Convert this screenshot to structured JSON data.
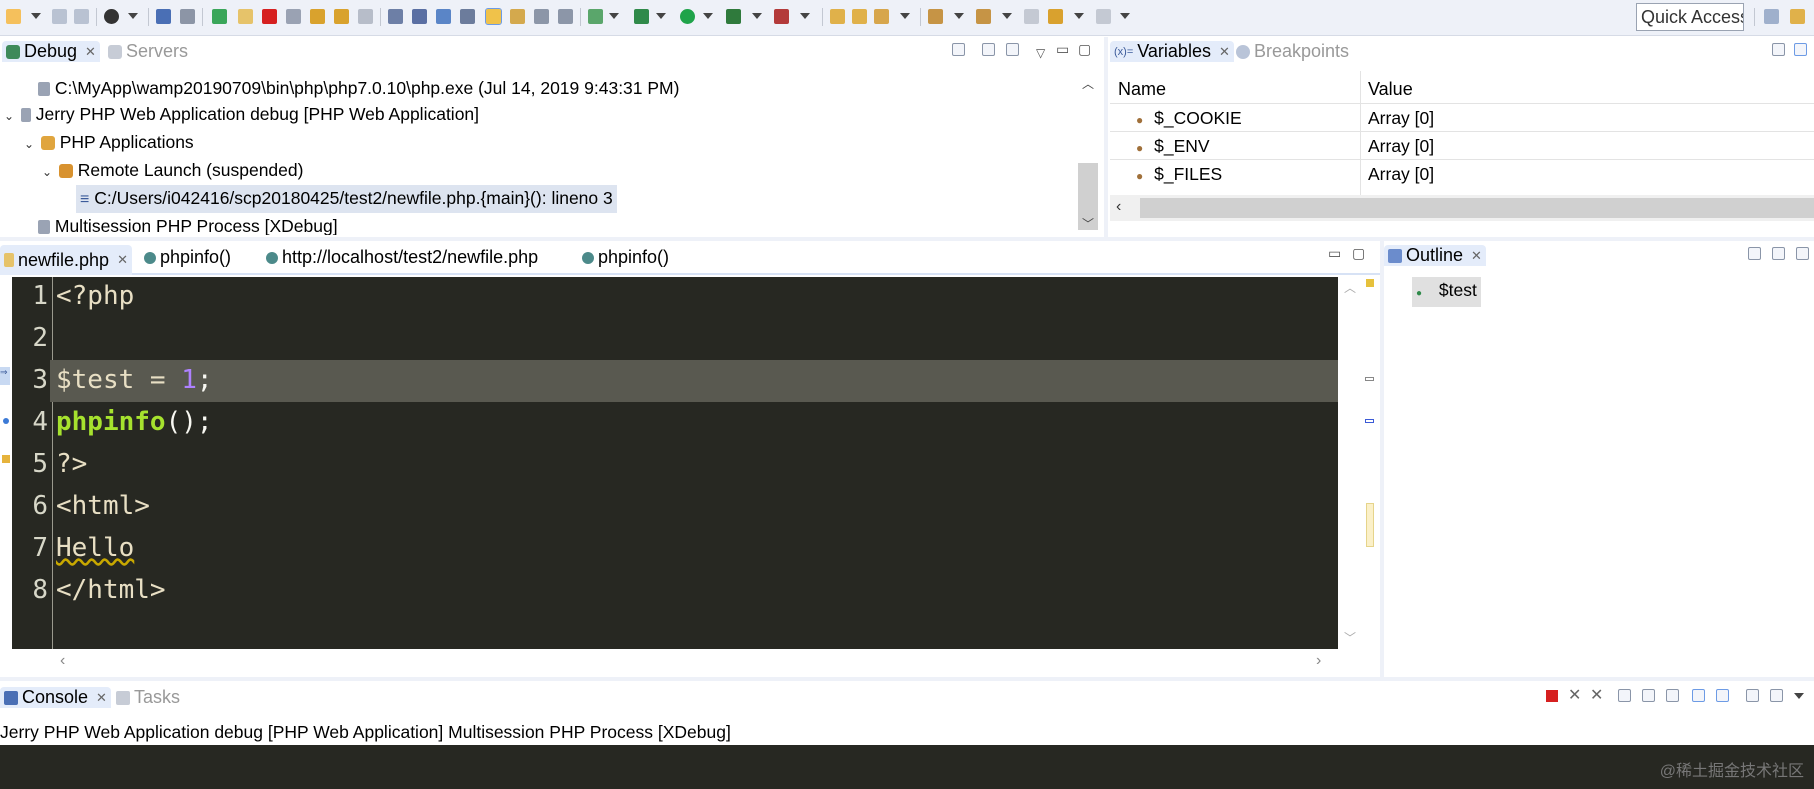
{
  "toolbar": {
    "quick_access": "Quick Access"
  },
  "debug_view": {
    "tabs": [
      {
        "label": "Debug"
      },
      {
        "label": "Servers"
      }
    ],
    "tree": [
      "C:\\MyApp\\wamp20190709\\bin\\php\\php7.0.10\\php.exe (Jul 14, 2019 9:43:31 PM)",
      "Jerry PHP Web Application debug [PHP Web Application]",
      "PHP Applications",
      "Remote Launch (suspended)",
      "C:/Users/i042416/scp20180425/test2/newfile.php.{main}(): lineno 3",
      "Multisession PHP Process [XDebug]"
    ]
  },
  "variables_view": {
    "tabs": [
      {
        "label": "Variables"
      },
      {
        "label": "Breakpoints"
      }
    ],
    "columns": [
      "Name",
      "Value"
    ],
    "rows": [
      {
        "name": "$_COOKIE",
        "value": "Array [0]"
      },
      {
        "name": "$_ENV",
        "value": "Array [0]"
      },
      {
        "name": "$_FILES",
        "value": "Array [0]"
      }
    ]
  },
  "editor": {
    "tabs": [
      {
        "label": "newfile.php"
      },
      {
        "label": "phpinfo()"
      },
      {
        "label": "http://localhost/test2/newfile.php"
      },
      {
        "label": "phpinfo()"
      }
    ],
    "line_numbers": [
      "1",
      "2",
      "3",
      "4",
      "5",
      "6",
      "7",
      "8"
    ],
    "lines": [
      "<?php",
      "",
      "$test = ",
      "1",
      ";",
      "phpinfo",
      "();",
      "?>",
      "<html>",
      "Hello",
      "</html>"
    ],
    "current_line": 3
  },
  "outline_view": {
    "tab": "Outline",
    "items": [
      "$test"
    ]
  },
  "console_view": {
    "tabs": [
      {
        "label": "Console"
      },
      {
        "label": "Tasks"
      }
    ],
    "description": "Jerry PHP Web Application debug [PHP Web Application] Multisession PHP Process [XDebug]"
  },
  "watermark": "@稀土掘金技术社区",
  "colors": {
    "editor_bg": "#272822",
    "keyword": "#a6e22e",
    "number": "#ae81ff",
    "current_line": "#595950"
  }
}
